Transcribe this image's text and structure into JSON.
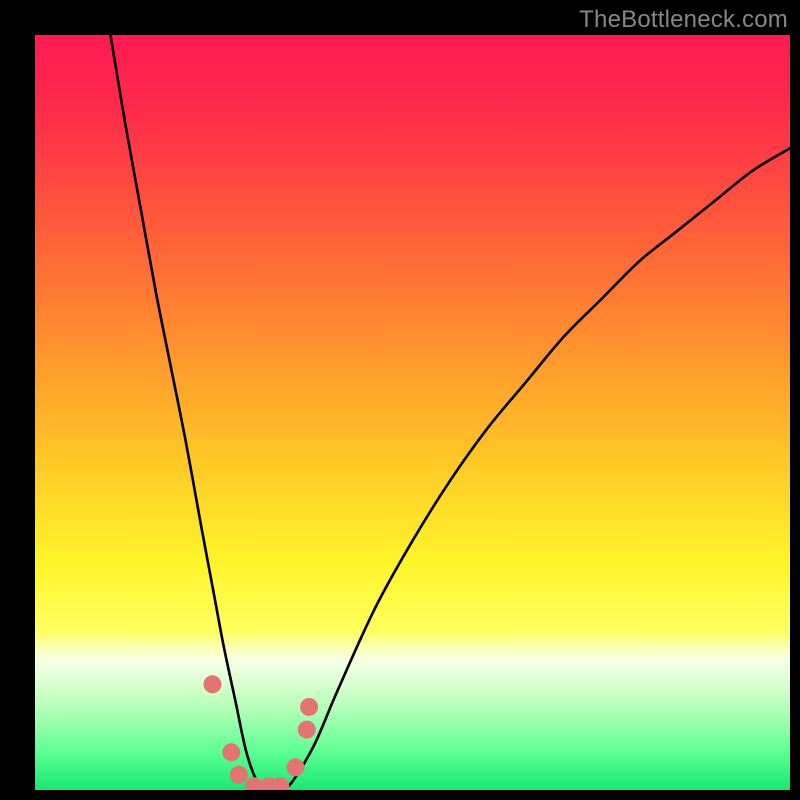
{
  "watermark": "TheBottleneck.com",
  "chart_data": {
    "type": "line",
    "title": "",
    "xlabel": "",
    "ylabel": "",
    "xlim": [
      0,
      100
    ],
    "ylim": [
      0,
      100
    ],
    "gradient_stops": [
      {
        "offset": 0.0,
        "color": "#ff1a51"
      },
      {
        "offset": 0.1,
        "color": "#ff2b4a"
      },
      {
        "offset": 0.25,
        "color": "#ff5a3a"
      },
      {
        "offset": 0.4,
        "color": "#ff8e2e"
      },
      {
        "offset": 0.55,
        "color": "#ffc326"
      },
      {
        "offset": 0.7,
        "color": "#fff52a"
      },
      {
        "offset": 0.79,
        "color": "#ffff60"
      },
      {
        "offset": 0.815,
        "color": "#fbffc0"
      },
      {
        "offset": 0.83,
        "color": "#f4ffe6"
      },
      {
        "offset": 0.86,
        "color": "#d9ffcf"
      },
      {
        "offset": 0.9,
        "color": "#a8ffb3"
      },
      {
        "offset": 0.95,
        "color": "#5cff93"
      },
      {
        "offset": 1.0,
        "color": "#17e872"
      }
    ],
    "series": [
      {
        "name": "bottleneck-curve",
        "x": [
          10,
          12,
          14,
          16,
          18,
          20,
          22,
          23.5,
          25,
          26.5,
          28,
          29.5,
          31,
          32.5,
          34,
          37,
          40,
          45,
          50,
          55,
          60,
          65,
          70,
          75,
          80,
          85,
          90,
          95,
          100
        ],
        "y": [
          100,
          88,
          77,
          66,
          56,
          46,
          35,
          27,
          19,
          12,
          5,
          1,
          0,
          0,
          1,
          6,
          13,
          24,
          33,
          41,
          48,
          54,
          60,
          65,
          70,
          74,
          78,
          82,
          85
        ]
      }
    ],
    "markers": {
      "name": "highlight-dots",
      "color": "#e57373",
      "radius": 9,
      "points": [
        {
          "x": 23.5,
          "y": 14
        },
        {
          "x": 26.0,
          "y": 5
        },
        {
          "x": 27.0,
          "y": 2
        },
        {
          "x": 29.0,
          "y": 0.5
        },
        {
          "x": 31.0,
          "y": 0.5
        },
        {
          "x": 32.5,
          "y": 0.5
        },
        {
          "x": 34.5,
          "y": 3
        },
        {
          "x": 36.0,
          "y": 8
        },
        {
          "x": 36.3,
          "y": 11
        }
      ]
    }
  }
}
